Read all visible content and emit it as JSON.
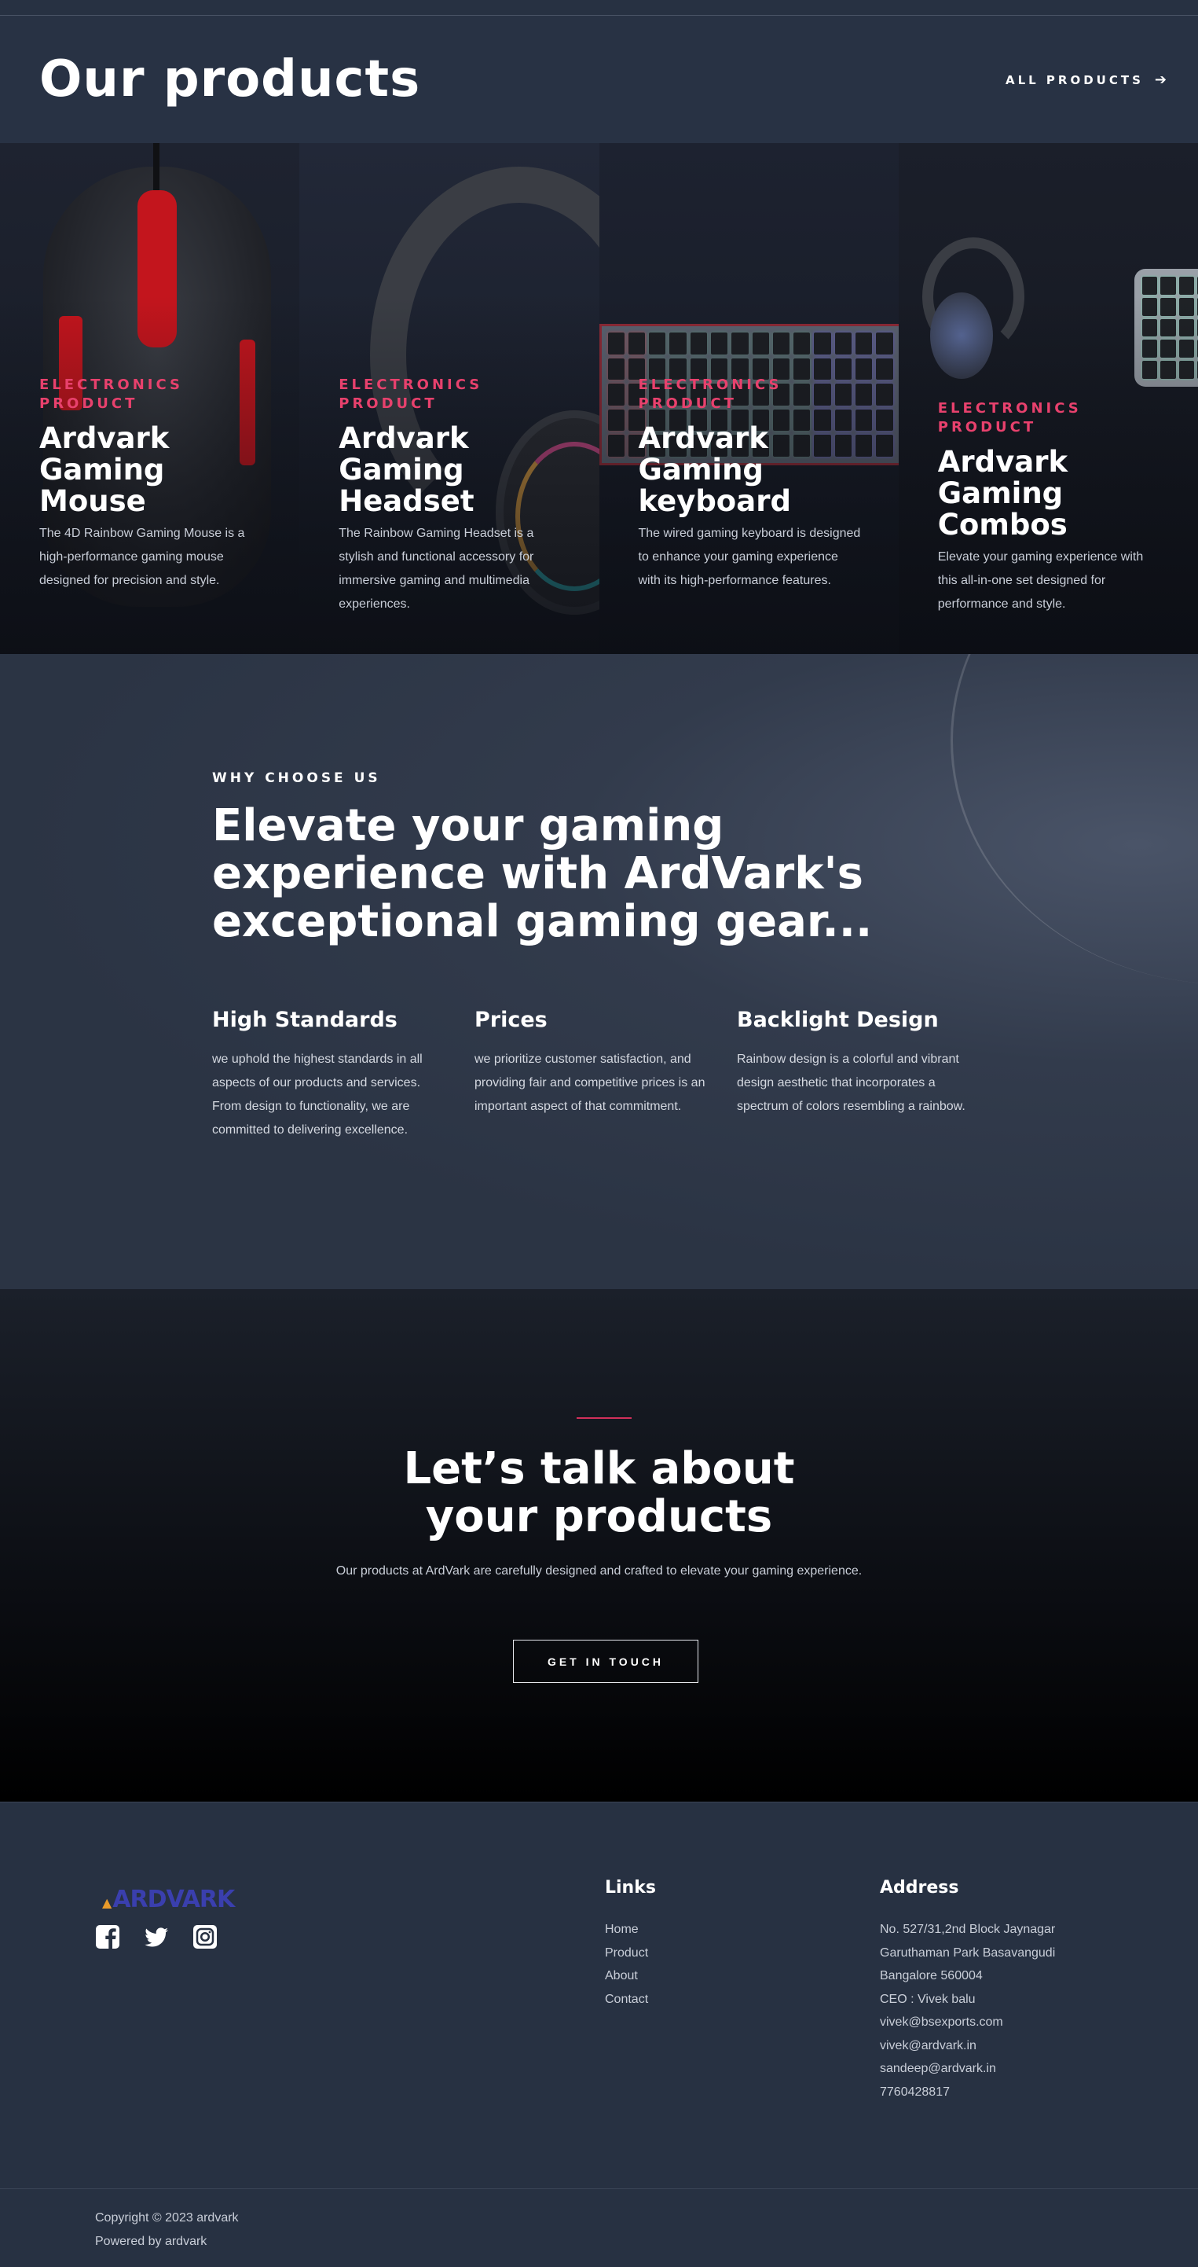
{
  "products_section": {
    "title": "Our products",
    "all_products_label": "ALL PRODUCTS",
    "cards": [
      {
        "eyebrow": "ELECTRONICS PRODUCT",
        "title": "Ardvark Gaming Mouse",
        "description": "The 4D Rainbow Gaming Mouse is a high-performance gaming mouse designed for precision and style."
      },
      {
        "eyebrow": "ELECTRONICS PRODUCT",
        "title": "Ardvark Gaming Headset",
        "description": "The Rainbow Gaming Headset is a stylish and functional accessory for immersive gaming and multimedia experiences."
      },
      {
        "eyebrow": "ELECTRONICS PRODUCT",
        "title": "Ardvark Gaming keyboard",
        "description": "The wired gaming keyboard is designed to enhance your gaming experience with its high-performance features."
      },
      {
        "eyebrow": "ELECTRONICS PRODUCT",
        "title": "Ardvark Gaming Combos",
        "description": "Elevate your gaming experience with this all-in-one set designed for performance and style."
      }
    ]
  },
  "why_section": {
    "eyebrow": "WHY CHOOSE US",
    "title": "Elevate your gaming experience with ArdVark's exceptional gaming gear...",
    "features": [
      {
        "heading": "High Standards",
        "text": "we uphold the highest standards in all aspects of our products and services. From design to functionality, we are committed to delivering excellence."
      },
      {
        "heading": "Prices",
        "text": "we prioritize customer satisfaction, and providing fair and competitive prices is an important aspect of that commitment."
      },
      {
        "heading": "Backlight Design",
        "text": "Rainbow design is a colorful and vibrant design aesthetic that incorporates a spectrum of colors resembling a rainbow."
      }
    ]
  },
  "talk_section": {
    "title_line1": "Let’s talk about",
    "title_line2": "your products",
    "description": "Our products at ArdVark are carefully designed and crafted to elevate your gaming experience.",
    "button_label": "GET IN TOUCH"
  },
  "footer": {
    "logo_text": "ARDVARK",
    "socials": [
      "facebook-icon",
      "twitter-icon",
      "instagram-icon"
    ],
    "links_heading": "Links",
    "links": [
      "Home",
      "Product",
      "About",
      "Contact"
    ],
    "address_heading": "Address",
    "address_lines": [
      "No. 527/31,2nd Block Jaynagar",
      "Garuthaman Park Basavangudi",
      "Bangalore 560004",
      "CEO : Vivek balu",
      "vivek@bsexports.com",
      "vivek@ardvark.in",
      "sandeep@ardvark.in",
      "7760428817"
    ],
    "copyright": "Copyright © 2023 ardvark",
    "powered_by": "Powered by ardvark"
  },
  "colors": {
    "accent": "#e8416d",
    "background": "#273142",
    "logo": "#3a3fae"
  }
}
